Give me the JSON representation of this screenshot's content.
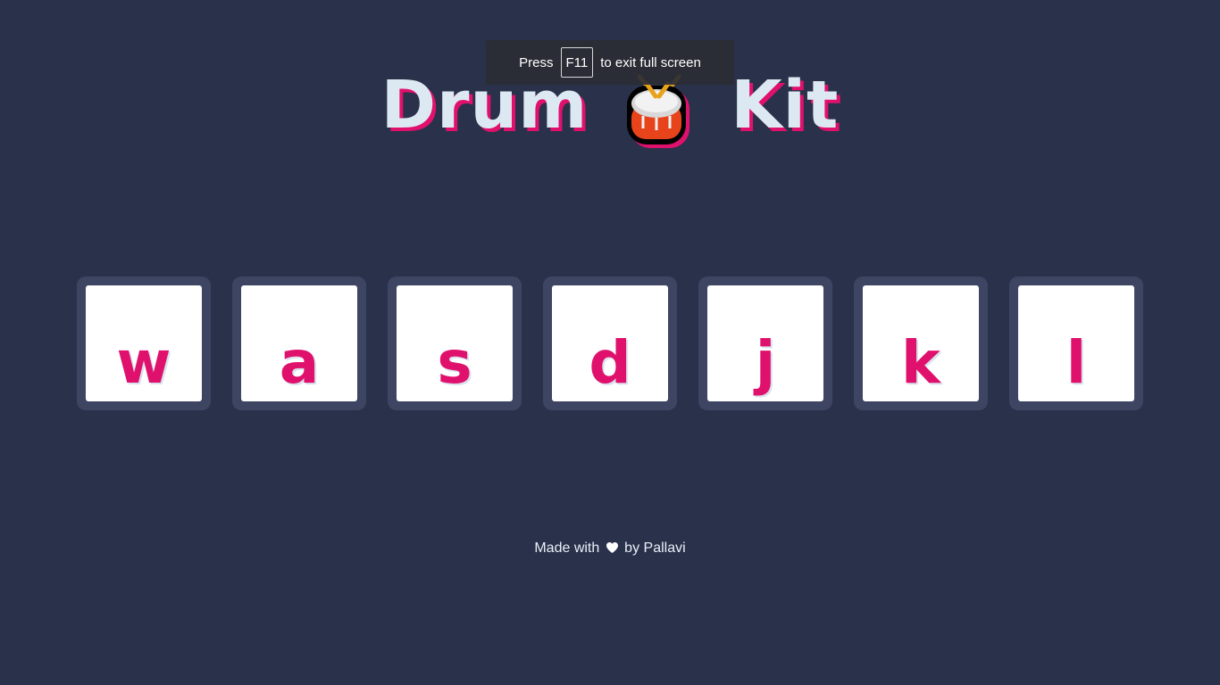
{
  "title": {
    "word_left": "Drum",
    "icon": "drum-icon",
    "word_right": "Kit"
  },
  "fullscreen_notice": {
    "prefix": "Press",
    "key": "F11",
    "suffix": "to exit full screen"
  },
  "keys": [
    {
      "letter": "w"
    },
    {
      "letter": "a"
    },
    {
      "letter": "s"
    },
    {
      "letter": "d"
    },
    {
      "letter": "j"
    },
    {
      "letter": "k"
    },
    {
      "letter": "l"
    }
  ],
  "footer": {
    "prefix": "Made with",
    "icon": "heart-icon",
    "suffix": "by Pallavi"
  },
  "colors": {
    "background": "#2a314a",
    "key_frame": "#3d4563",
    "accent": "#e0116d",
    "title_text": "#dde9f2"
  }
}
